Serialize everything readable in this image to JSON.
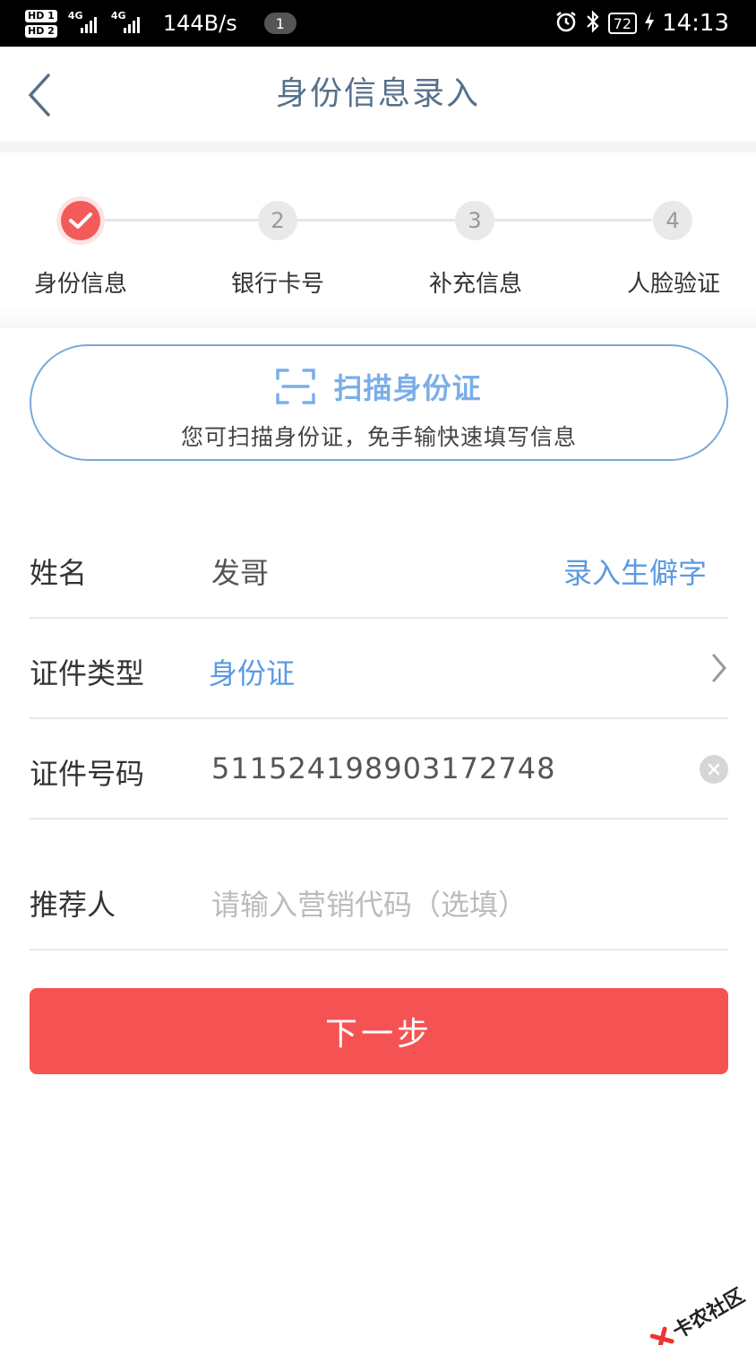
{
  "status_bar": {
    "hd1": "HD 1",
    "hd2": "HD 2",
    "net1": "4G",
    "net2": "4G",
    "speed": "144B/s",
    "notification_count": "1",
    "battery": "72",
    "time": "14:13"
  },
  "header": {
    "title": "身份信息录入"
  },
  "steps": [
    {
      "number": "",
      "label": "身份信息",
      "state": "done"
    },
    {
      "number": "2",
      "label": "银行卡号",
      "state": "pending"
    },
    {
      "number": "3",
      "label": "补充信息",
      "state": "pending"
    },
    {
      "number": "4",
      "label": "人脸验证",
      "state": "pending"
    }
  ],
  "scan": {
    "title": "扫描身份证",
    "subtitle": "您可扫描身份证，免手输快速填写信息"
  },
  "form": {
    "name": {
      "label": "姓名",
      "value": "发哥",
      "action": "录入生僻字"
    },
    "id_type": {
      "label": "证件类型",
      "value": "身份证"
    },
    "id_number": {
      "label": "证件号码",
      "value": "511524198903172748"
    },
    "referrer": {
      "label": "推荐人",
      "placeholder": "请输入营销代码（选填）"
    }
  },
  "next_button": {
    "label": "下一步"
  },
  "watermark": {
    "text": "卡农社区"
  },
  "colors": {
    "accent_red": "#f55353",
    "link_blue": "#5b9ae0",
    "title_gray_blue": "#56708a"
  }
}
